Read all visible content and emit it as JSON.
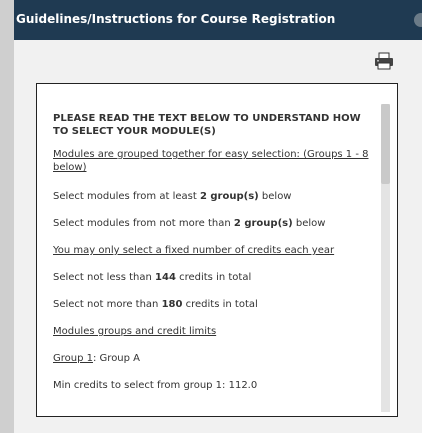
{
  "dialog": {
    "title": "Guidelines/Instructions for Course Registration"
  },
  "toolbar": {
    "print_icon": "printer-icon"
  },
  "content": {
    "heading": "PLEASE READ THE TEXT BELOW TO UNDERSTAND HOW TO SELECT YOUR MODULE(S)",
    "groups_link": "Modules are grouped together for easy selection: (Groups 1 - 8 below)",
    "min_groups_prefix": "Select modules from at least ",
    "min_groups_value": "2 group(s)",
    "min_groups_suffix": " below",
    "max_groups_prefix": "Select modules from not more than ",
    "max_groups_value": "2 group(s)",
    "max_groups_suffix": " below",
    "fixed_credits_link": "You may only select a fixed number of credits each year",
    "min_credits_prefix": "Select not less than ",
    "min_credits_value": "144",
    "min_credits_suffix": " credits in total",
    "max_credits_prefix": "Select not more than ",
    "max_credits_value": "180",
    "max_credits_suffix": " credits in total",
    "limits_link": "Modules groups and credit limits",
    "group1_link": "Group 1",
    "group1_rest": ": Group A",
    "group1_min": "Min credits to select from group 1: 112.0"
  }
}
